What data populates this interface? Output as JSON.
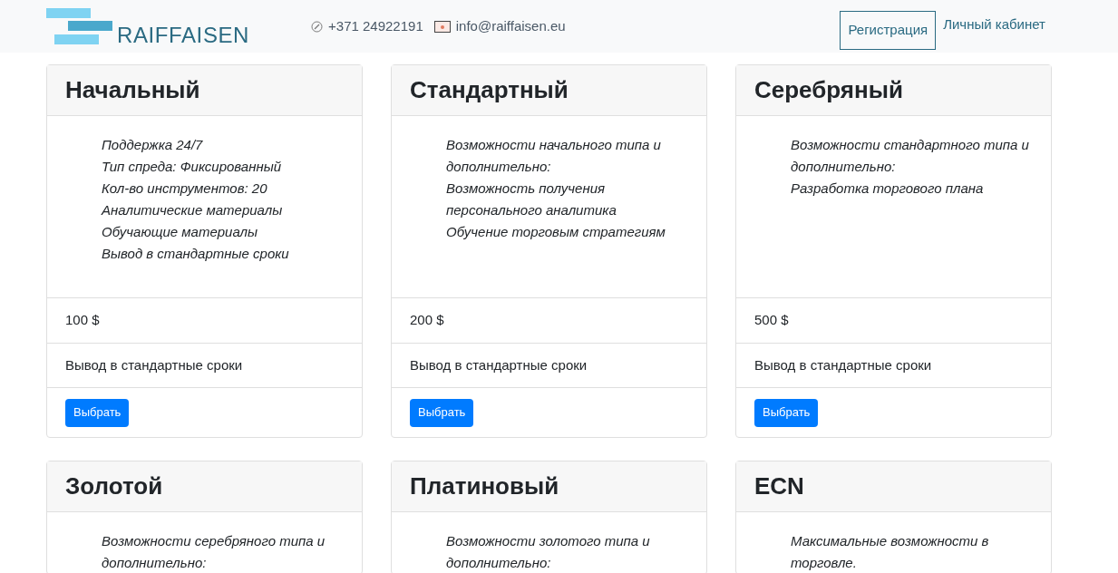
{
  "header": {
    "logo_text": "RAIFFAISEN",
    "phone": "+371 24922191",
    "email": "info@raiffaisen.eu",
    "register_button": "Регистрация",
    "account_link": "Личный кабинет"
  },
  "plans": [
    {
      "title": "Начальный",
      "features": [
        "Поддержка 24/7",
        "Тип спреда: Фиксированный",
        "Кол-во инструментов: 20",
        "Аналитические материалы",
        "Обучающие материалы",
        "Вывод в стандартные сроки"
      ],
      "price": "100 $",
      "withdrawal": "Вывод в стандартные сроки",
      "button": "Выбрать"
    },
    {
      "title": "Стандартный",
      "features": [
        "Возможности начального типа и дополнительно:",
        "Возможность получения персонального аналитика",
        "Обучение торговым стратегиям"
      ],
      "price": "200 $",
      "withdrawal": "Вывод в стандартные сроки",
      "button": "Выбрать"
    },
    {
      "title": "Серебряный",
      "features": [
        "Возможности стандартного типа и дополнительно:",
        "Разработка торгового плана"
      ],
      "price": "500 $",
      "withdrawal": "Вывод в стандартные сроки",
      "button": "Выбрать"
    },
    {
      "title": "Золотой",
      "features": [
        "Возможности серебряного типа и дополнительно:"
      ]
    },
    {
      "title": "Платиновый",
      "features": [
        "Возможности золотого типа и дополнительно:"
      ]
    },
    {
      "title": "ECN",
      "features": [
        "Максимальные возможности в торговле."
      ]
    }
  ]
}
